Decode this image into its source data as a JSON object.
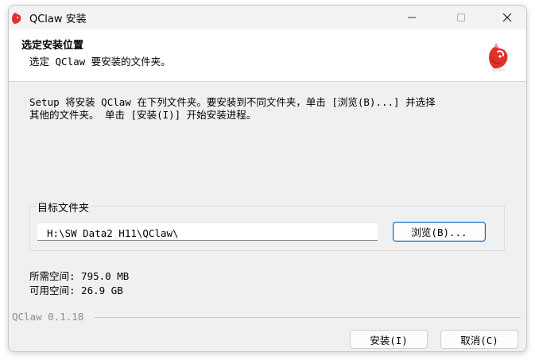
{
  "window": {
    "title": "QClaw 安装"
  },
  "header": {
    "title": "选定安装位置",
    "subtitle": "选定 QClaw 要安装的文件夹。"
  },
  "body": {
    "description_line1": "Setup 将安装 QClaw 在下列文件夹。要安装到不同文件夹，单击 [浏览(B)...] 并选择",
    "description_line2": "其他的文件夹。 单击 [安装(I)] 开始安装进程。",
    "destination_group_label": "目标文件夹",
    "destination_path": "H:\\SW Data2 H11\\QClaw\\",
    "browse_label": "浏览(B)...",
    "space_required": "所需空间: 795.0 MB",
    "space_available": "可用空间: 26.9 GB"
  },
  "footer": {
    "version": "QClaw 0.1.18",
    "install_label": "安装(I)",
    "cancel_label": "取消(C)"
  },
  "colors": {
    "accent": "#0067c0",
    "logo_red": "#e0322a",
    "window_bg": "#f0f0f0"
  },
  "icons": {
    "app": "crab-claw-icon",
    "minimize": "minimize-icon",
    "maximize": "maximize-icon",
    "close": "close-icon",
    "header_logo": "crab-claw-logo"
  }
}
